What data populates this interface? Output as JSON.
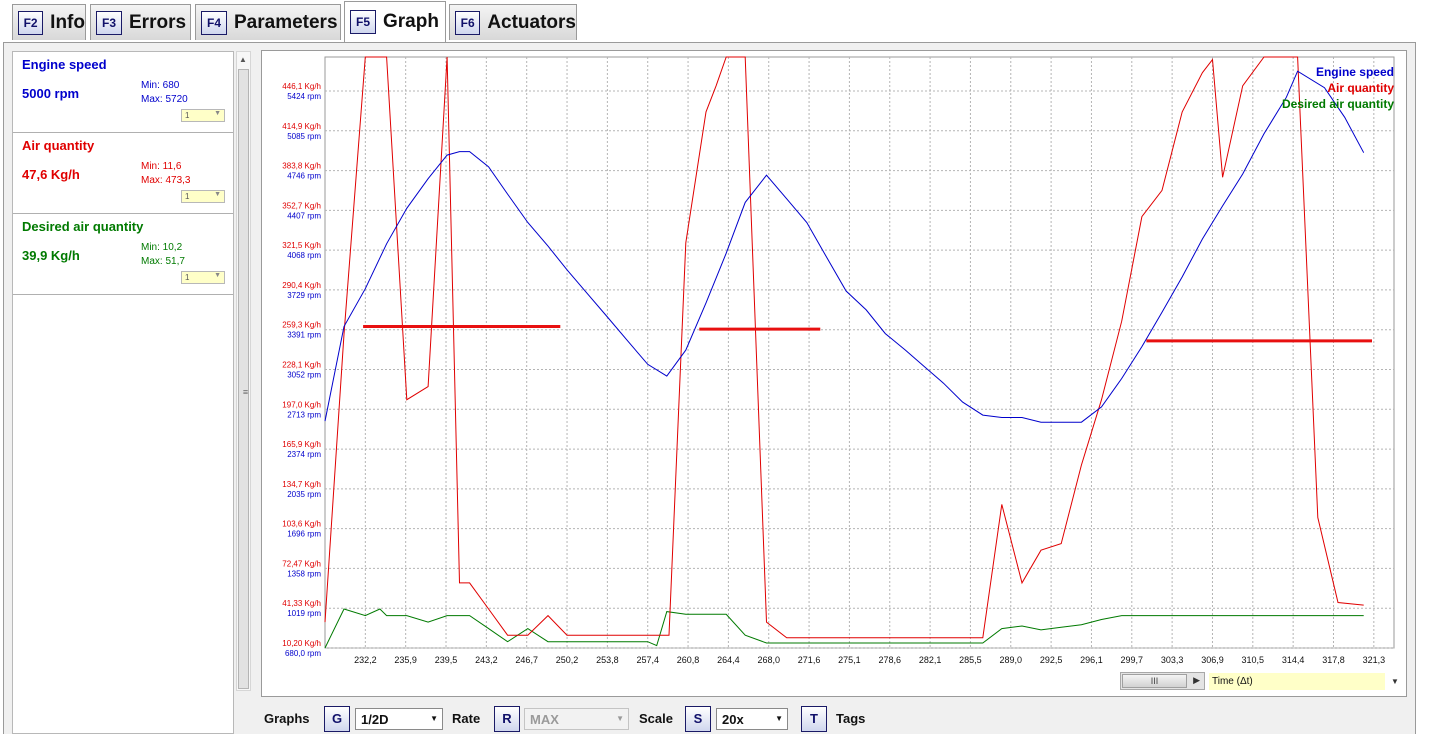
{
  "tabs": [
    {
      "key": "F2",
      "label": "Info"
    },
    {
      "key": "F3",
      "label": "Errors"
    },
    {
      "key": "F4",
      "label": "Parameters"
    },
    {
      "key": "F5",
      "label": "Graph"
    },
    {
      "key": "F6",
      "label": "Actuators"
    }
  ],
  "active_tab": "Graph",
  "sensors": [
    {
      "name": "Engine speed",
      "value": "5000 rpm",
      "min": "Min: 680",
      "max": "Max: 5720",
      "selector": "1",
      "color": "#0000cc"
    },
    {
      "name": "Air quantity",
      "value": "47,6 Kg/h",
      "min": "Min: 11,6",
      "max": "Max: 473,3",
      "selector": "1",
      "color": "#e00000"
    },
    {
      "name": "Desired air quantity",
      "value": "39,9 Kg/h",
      "min": "Min: 10,2",
      "max": "Max: 51,7",
      "selector": "1",
      "color": "#007a00"
    }
  ],
  "chart_data": {
    "type": "line",
    "xlabel": "Time (Δt)",
    "x_ticks": [
      "232,2",
      "235,9",
      "239,5",
      "243,2",
      "246,7",
      "250,2",
      "253,8",
      "257,4",
      "260,8",
      "264,4",
      "268,0",
      "271,6",
      "275,1",
      "278,6",
      "282,1",
      "285,5",
      "289,0",
      "292,5",
      "296,1",
      "299,7",
      "303,3",
      "306,9",
      "310,5",
      "314,4",
      "317,8",
      "321,3"
    ],
    "y_ticks_air": [
      "446,1 Kg/h",
      "414,9 Kg/h",
      "383,8 Kg/h",
      "352,7 Kg/h",
      "321,5 Kg/h",
      "290,4 Kg/h",
      "259,3 Kg/h",
      "228,1 Kg/h",
      "197,0 Kg/h",
      "165,9 Kg/h",
      "134,7 Kg/h",
      "103,6 Kg/h",
      "72,47 Kg/h",
      "41,33 Kg/h",
      "10,20 Kg/h"
    ],
    "y_ticks_rpm": [
      "5424 rpm",
      "5085 rpm",
      "4746 rpm",
      "4407 rpm",
      "4068 rpm",
      "3729 rpm",
      "3391 rpm",
      "3052 rpm",
      "2713 rpm",
      "2374 rpm",
      "2035 rpm",
      "1696 rpm",
      "1358 rpm",
      "1019 rpm",
      "680,0 rpm"
    ],
    "xlim": [
      228.6,
      324.0
    ],
    "ylim_air": [
      10.2,
      462.0
    ],
    "ylim_rpm": [
      680,
      5680
    ],
    "legend": [
      "Engine speed",
      "Air quantity",
      "Desired air quantity"
    ],
    "legend_position": "top-right",
    "grid": true,
    "series": [
      {
        "name": "Engine speed",
        "color": "#0000cc",
        "unit": "rpm",
        "x": [
          228.6,
          230.3,
          232.2,
          234.1,
          235.9,
          237.8,
          239.5,
          240.6,
          241.5,
          243.2,
          244.9,
          246.7,
          248.5,
          250.2,
          252.0,
          253.8,
          255.6,
          257.4,
          259.1,
          260.8,
          262.6,
          264.4,
          266.1,
          268.0,
          269.8,
          271.6,
          273.4,
          275.1,
          276.9,
          278.6,
          280.4,
          282.1,
          283.8,
          285.5,
          287.3,
          289.0,
          290.8,
          292.5,
          294.3,
          296.1,
          297.9,
          299.7,
          301.5,
          303.3,
          305.1,
          306.9,
          308.7,
          310.5,
          312.4,
          314.4,
          315.4,
          317.8,
          319.6,
          321.3
        ],
        "y": [
          2600,
          3400,
          3720,
          4100,
          4400,
          4650,
          4850,
          4880,
          4880,
          4750,
          4520,
          4280,
          4080,
          3880,
          3680,
          3480,
          3280,
          3080,
          2980,
          3200,
          3600,
          4020,
          4450,
          4680,
          4480,
          4280,
          3980,
          3700,
          3540,
          3340,
          3200,
          3060,
          2920,
          2760,
          2650,
          2630,
          2630,
          2590,
          2590,
          2590,
          2720,
          2960,
          3230,
          3520,
          3820,
          4140,
          4420,
          4690,
          5030,
          5340,
          5560,
          5420,
          5170,
          4870
        ]
      },
      {
        "name": "Air quantity",
        "color": "#e00000",
        "unit": "Kg/h",
        "x": [
          228.6,
          230.3,
          232.2,
          233.5,
          234.1,
          235.9,
          237.8,
          239.5,
          240.6,
          241.5,
          243.2,
          244.9,
          246.7,
          248.5,
          250.2,
          253.8,
          257.4,
          259.3,
          260.8,
          262.6,
          263.5,
          264.4,
          266.1,
          268.0,
          269.8,
          271.6,
          275.1,
          278.6,
          282.1,
          285.5,
          287.3,
          289.0,
          290.8,
          292.5,
          294.3,
          296.1,
          297.9,
          299.7,
          301.5,
          303.3,
          305.1,
          306.9,
          307.8,
          308.7,
          310.5,
          312.4,
          314.4,
          315.4,
          317.2,
          319.0,
          321.3
        ],
        "y": [
          30,
          250,
          462,
          462,
          462,
          200,
          210,
          462,
          60,
          60,
          40,
          20,
          20,
          35,
          20,
          20,
          20,
          20,
          320,
          420,
          440,
          462,
          462,
          30,
          18,
          18,
          18,
          18,
          18,
          18,
          18,
          120,
          60,
          85,
          90,
          150,
          200,
          260,
          340,
          360,
          420,
          450,
          460,
          370,
          440,
          462,
          462,
          462,
          110,
          45,
          43
        ]
      },
      {
        "name": "Desired air quantity",
        "color": "#007a00",
        "unit": "Kg/h",
        "x": [
          228.6,
          230.3,
          232.2,
          233.5,
          234.1,
          235.9,
          237.8,
          239.5,
          240.6,
          241.5,
          243.2,
          244.9,
          246.7,
          248.5,
          250.2,
          253.8,
          257.4,
          258.2,
          259.1,
          260.8,
          262.6,
          264.4,
          266.1,
          268.0,
          269.8,
          271.6,
          275.1,
          278.6,
          282.1,
          285.5,
          287.3,
          289.0,
          290.8,
          292.5,
          294.3,
          296.1,
          297.9,
          299.7,
          301.5,
          303.3,
          305.1,
          306.9,
          310.5,
          314.4,
          317.8,
          321.3
        ],
        "y": [
          10,
          40,
          35,
          40,
          35,
          35,
          30,
          35,
          35,
          35,
          25,
          15,
          25,
          15,
          15,
          15,
          15,
          12,
          38,
          36,
          36,
          36,
          20,
          14,
          14,
          14,
          14,
          14,
          14,
          14,
          14,
          25,
          27,
          24,
          26,
          28,
          32,
          35,
          35,
          35,
          35,
          35,
          35,
          35,
          35,
          35
        ]
      }
    ],
    "markers": [
      {
        "x0": 232.0,
        "x1": 249.6,
        "y": 256
      },
      {
        "x0": 262.0,
        "x1": 272.8,
        "y": 254
      },
      {
        "x0": 301.9,
        "x1": 327.0,
        "y": 245
      }
    ],
    "marker_color": "#e81010"
  },
  "controls": {
    "graphs_label": "Graphs",
    "graphs_key": "G",
    "graphs_value": "1/2D",
    "rate_label": "Rate",
    "rate_key": "R",
    "rate_value": "MAX",
    "scale_label": "Scale",
    "scale_key": "S",
    "scale_value": "20x",
    "tags_key": "T",
    "tags_label": "Tags"
  },
  "hscroll_grip": "III",
  "time_selector": "Time (Δt)"
}
